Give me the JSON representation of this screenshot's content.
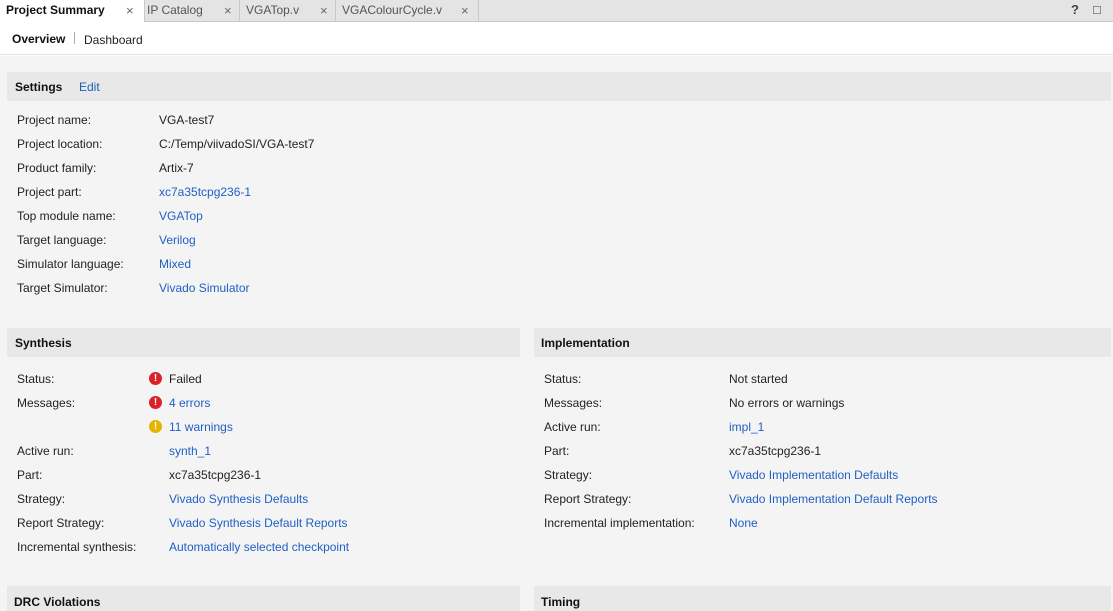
{
  "tabs": [
    {
      "label": "Project Summary",
      "active": true
    },
    {
      "label": "IP Catalog",
      "active": false
    },
    {
      "label": "VGATop.v",
      "active": false
    },
    {
      "label": "VGAColourCycle.v",
      "active": false
    }
  ],
  "tab_close_glyph": "×",
  "window_controls": {
    "help": "?",
    "maximize": "□"
  },
  "subnav": {
    "overview": "Overview",
    "dashboard": "Dashboard"
  },
  "settings": {
    "title": "Settings",
    "edit": "Edit",
    "rows": [
      {
        "label": "Project name:",
        "value": "VGA-test7"
      },
      {
        "label": "Project location:",
        "value": "C:/Temp/viivadoSI/VGA-test7"
      },
      {
        "label": "Product family:",
        "value": "Artix-7"
      },
      {
        "label": "Project part:",
        "value": "xc7a35tcpg236-1"
      },
      {
        "label": "Top module name:",
        "value": "VGATop"
      },
      {
        "label": "Target language:",
        "value": "Verilog"
      },
      {
        "label": "Simulator language:",
        "value": "Mixed"
      },
      {
        "label": "Target Simulator:",
        "value": "Vivado Simulator"
      }
    ]
  },
  "synthesis": {
    "title": "Synthesis",
    "status_label": "Status:",
    "status_value": "Failed",
    "messages_label": "Messages:",
    "errors": "4 errors",
    "warnings": "11 warnings",
    "active_run_label": "Active run:",
    "active_run": "synth_1",
    "part_label": "Part:",
    "part": "xc7a35tcpg236-1",
    "strategy_label": "Strategy:",
    "strategy": "Vivado Synthesis Defaults",
    "report_strategy_label": "Report Strategy:",
    "report_strategy": "Vivado Synthesis Default Reports",
    "incremental_label": "Incremental synthesis:",
    "incremental": "Automatically selected checkpoint"
  },
  "implementation": {
    "title": "Implementation",
    "status_label": "Status:",
    "status_value": "Not started",
    "messages_label": "Messages:",
    "messages": "No errors or warnings",
    "active_run_label": "Active run:",
    "active_run": "impl_1",
    "part_label": "Part:",
    "part": "xc7a35tcpg236-1",
    "strategy_label": "Strategy:",
    "strategy": "Vivado Implementation Defaults",
    "report_strategy_label": "Report Strategy:",
    "report_strategy": "Vivado Implementation Default Reports",
    "incremental_label": "Incremental implementation:",
    "incremental": "None"
  },
  "drc": {
    "title": "DRC Violations"
  },
  "timing": {
    "title": "Timing"
  },
  "icons": {
    "error": "!",
    "warning": "!"
  },
  "colors": {
    "link": "#2160c4",
    "error": "#d9232a",
    "warning": "#e5b300",
    "header_bg": "#e8e8e8",
    "panel_bg": "#f4f4f4"
  }
}
